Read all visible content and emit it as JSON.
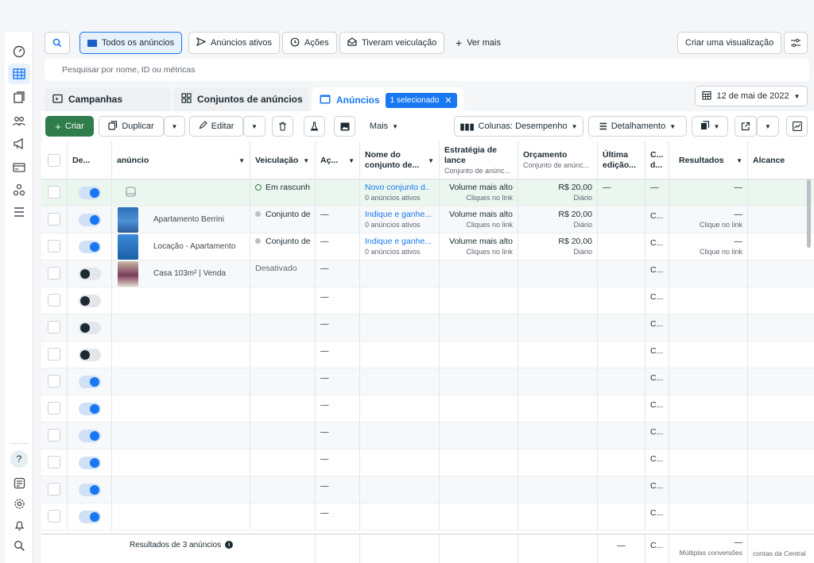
{
  "filters": {
    "all_ads": "Todos os anúncios",
    "active_ads": "Anúncios ativos",
    "actions": "Ações",
    "had_delivery": "Tiveram veiculação",
    "see_more": "Ver mais",
    "create_view": "Criar uma visualização"
  },
  "search": {
    "placeholder": "Pesquisar por nome, ID ou métricas"
  },
  "tabs": {
    "campaigns": "Campanhas",
    "ad_sets": "Conjuntos de anúncios",
    "ads": "Anúncios",
    "selected_badge": "1 selecionado"
  },
  "date_range": "12 de mai de 2022",
  "toolbar": {
    "create": "Criar",
    "duplicate": "Duplicar",
    "edit": "Editar",
    "more": "Mais",
    "columns": "Colunas: Desempenho",
    "breakdown": "Detalhamento"
  },
  "columns": {
    "delivery_toggle": "De...",
    "ad": "anúncio",
    "delivery": "Veiculação",
    "actions": "Aç...",
    "ad_set_name": "Nome do conjunto de...",
    "bid_strategy": "Estratégia de lance",
    "bid_strategy_sub": "Conjunto de anúnc...",
    "budget": "Orçamento",
    "budget_sub": "Conjunto de anúnc...",
    "last_edit": "Última edição...",
    "c": "C... d...",
    "results": "Resultados",
    "reach": "Alcance"
  },
  "rows": [
    {
      "toggle": "on",
      "ad": "",
      "delivery": "Em rascunh",
      "actions": "",
      "adset": "Novo conjunto d..",
      "adset_sub": "0 anúncios ativos",
      "bid": "Volume mais alto",
      "bid_sub": "Cliques no link",
      "budget": "R$ 20,00",
      "budget_sub": "Diário",
      "last": "—",
      "c": "—",
      "results": "—",
      "results_sub": ""
    },
    {
      "toggle": "on",
      "ad": "Apartamento Berrini",
      "delivery": "Conjunto de",
      "actions": "—",
      "adset": "Indique e ganhe...",
      "adset_sub": "0 anúncios ativos",
      "bid": "Volume mais alto",
      "bid_sub": "Cliques no link",
      "budget": "R$ 20,00",
      "budget_sub": "Diário",
      "last": "",
      "c": "C...",
      "results": "—",
      "results_sub": "Clique no link"
    },
    {
      "toggle": "on",
      "ad": "Locação - Apartamento",
      "delivery": "Conjunto de",
      "actions": "—",
      "adset": "Indique e ganhe...",
      "adset_sub": "0 anúncios ativos",
      "bid": "Volume mais alto",
      "bid_sub": "Cliques no link",
      "budget": "R$ 20,00",
      "budget_sub": "Diário",
      "last": "",
      "c": "C...",
      "results": "—",
      "results_sub": "Clique no link"
    },
    {
      "toggle": "off",
      "ad": "Casa 103m² | Venda",
      "delivery": "Desativado",
      "actions": "—",
      "c": "C..."
    },
    {
      "toggle": "off",
      "actions": "—",
      "c": "C..."
    },
    {
      "toggle": "off",
      "actions": "—",
      "c": "C..."
    },
    {
      "toggle": "off",
      "actions": "—",
      "c": "C..."
    },
    {
      "toggle": "on",
      "actions": "—",
      "c": "C..."
    },
    {
      "toggle": "on",
      "actions": "—",
      "c": "C..."
    },
    {
      "toggle": "on",
      "actions": "—",
      "c": "C..."
    },
    {
      "toggle": "on",
      "actions": "—",
      "c": "C..."
    },
    {
      "toggle": "on",
      "actions": "—",
      "c": "C..."
    },
    {
      "toggle": "on",
      "actions": "—",
      "c": "C..."
    }
  ],
  "footer": {
    "results_of": "Resultados de 3 anúncios",
    "last": "—",
    "c": "C...",
    "results": "—",
    "results_sub": "Múltiplas conversões",
    "reach_sub": "contas da Central"
  },
  "colors": {
    "accent": "#1877f2",
    "create_green": "#2e7d4a",
    "draft_highlight": "#eaf6ee"
  }
}
